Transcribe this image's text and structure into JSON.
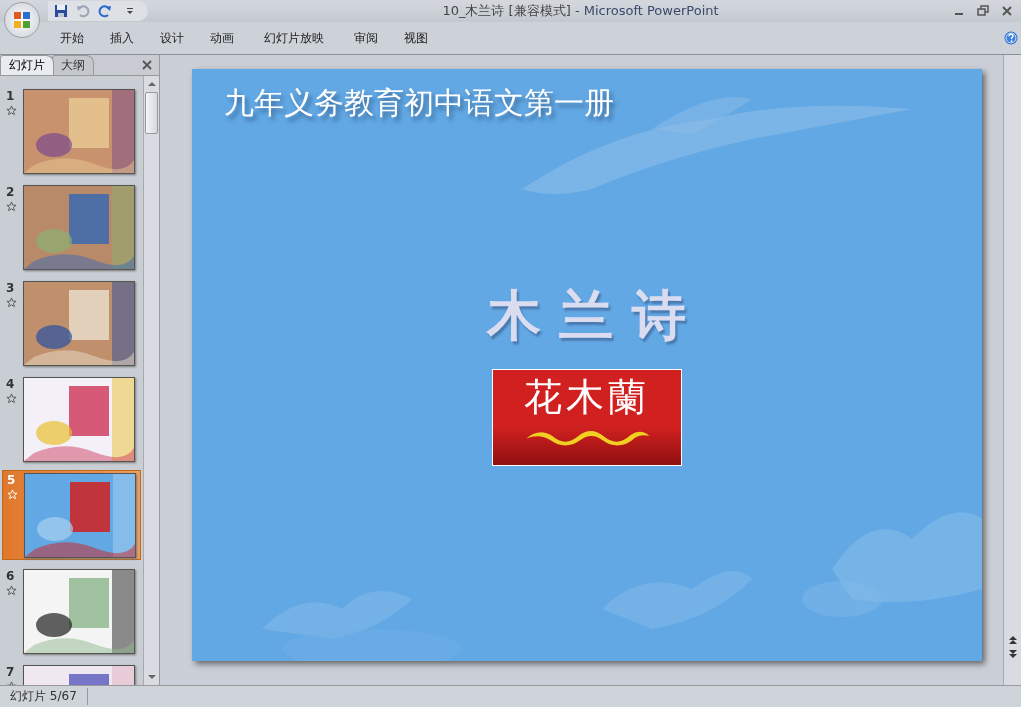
{
  "window": {
    "title": "10_木兰诗 [兼容模式]",
    "app": "- Microsoft PowerPoint"
  },
  "ribbon_tabs": [
    {
      "label": "开始"
    },
    {
      "label": "插入"
    },
    {
      "label": "设计"
    },
    {
      "label": "动画"
    },
    {
      "label": "幻灯片放映"
    },
    {
      "label": "审阅"
    },
    {
      "label": "视图"
    }
  ],
  "pane_tabs": [
    {
      "label": "幻灯片",
      "selected": true
    },
    {
      "label": "大纲",
      "selected": false
    }
  ],
  "slides": [
    {
      "number": "1",
      "selected": false
    },
    {
      "number": "2",
      "selected": false
    },
    {
      "number": "3",
      "selected": false
    },
    {
      "number": "4",
      "selected": false
    },
    {
      "number": "5",
      "selected": true
    },
    {
      "number": "6",
      "selected": false
    },
    {
      "number": "7",
      "selected": false
    }
  ],
  "slide": {
    "title": "九年义务教育初中语文第一册",
    "heading": "木 兰 诗",
    "banner": "花木蘭"
  },
  "status_bar": {
    "slide_counter": "幻灯片 5/67"
  }
}
